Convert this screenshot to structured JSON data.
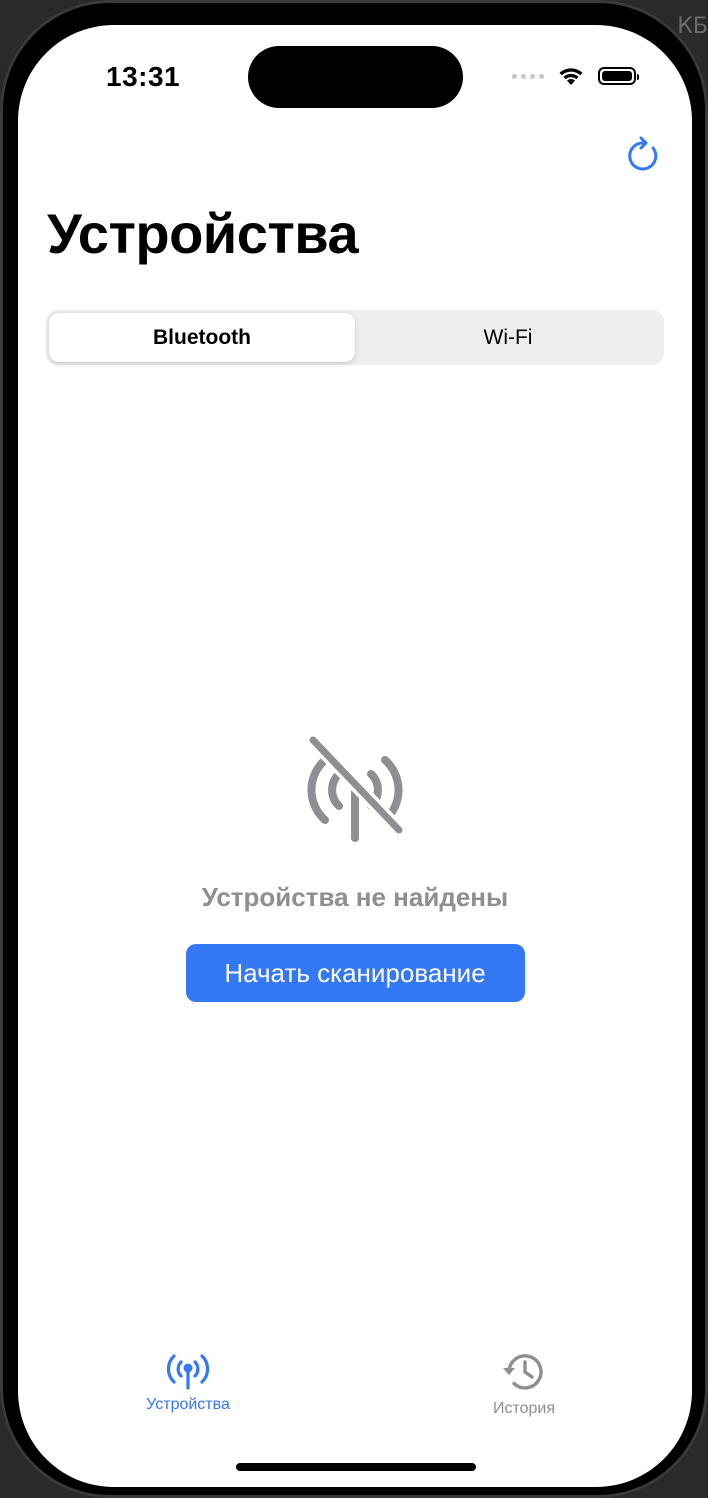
{
  "status_bar": {
    "time": "13:31"
  },
  "background": {
    "text": "КБ"
  },
  "header": {
    "title": "Устройства"
  },
  "segments": [
    {
      "label": "Bluetooth",
      "selected": true
    },
    {
      "label": "Wi-Fi",
      "selected": false
    }
  ],
  "empty_state": {
    "message": "Устройства не найдены",
    "button_label": "Начать сканирование",
    "icon": "antenna-slash-icon"
  },
  "tabs": [
    {
      "label": "Устройства",
      "icon": "antenna-icon",
      "active": true
    },
    {
      "label": "История",
      "icon": "history-clock-icon",
      "active": false
    }
  ],
  "colors": {
    "accent": "#3478f6",
    "secondary_text": "#8e8e93",
    "segment_bg": "#eeeeef"
  }
}
